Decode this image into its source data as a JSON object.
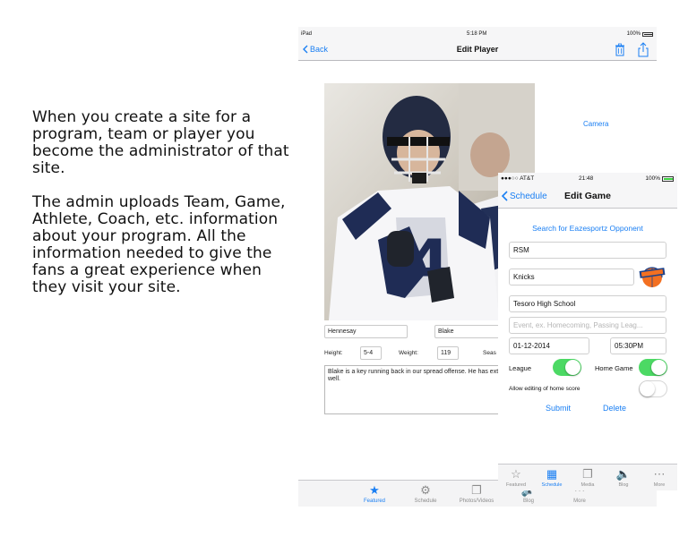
{
  "promo": {
    "paragraph1": "When you create a site for a program, team or player you become the administrator of that site.",
    "paragraph2": "The admin uploads Team, Game, Athlete, Coach, etc. information about your program. All the information needed to give the fans a great experience when they visit your site."
  },
  "ipad": {
    "status": {
      "device": "iPad",
      "time": "5:18 PM",
      "battery": "100%"
    },
    "nav": {
      "back_label": "Back",
      "title": "Edit Player"
    },
    "camera_label": "Camera",
    "fields": {
      "last_name": "Hennesay",
      "first_name": "Blake"
    },
    "labels": {
      "height": "Height:",
      "weight": "Weight:",
      "season": "Seas"
    },
    "values": {
      "height": "5-4",
      "weight": "119"
    },
    "bio": "Blake is a key running back in our spread offense. He has extremely well.",
    "tabs": [
      {
        "label": "Featured",
        "icon": "star-icon"
      },
      {
        "label": "Schedule",
        "icon": "schedule-icon"
      },
      {
        "label": "Photos/Videos",
        "icon": "photos-icon"
      },
      {
        "label": "Blog",
        "icon": "blog-icon"
      },
      {
        "label": "More",
        "icon": "more-icon"
      }
    ]
  },
  "iphone": {
    "status": {
      "carrier": "AT&T",
      "time": "21:48",
      "battery": "100%"
    },
    "nav": {
      "back_label": "Schedule",
      "title": "Edit Game"
    },
    "search_label": "Search for Eazesportz Opponent",
    "fields": {
      "team": "RSM",
      "opponent": "Knicks",
      "location": "Tesoro High School",
      "event_placeholder": "Event, ex. Homecoming, Passing Leag...",
      "date": "01-12-2014",
      "time": "05:30PM"
    },
    "labels": {
      "league": "League",
      "home_game": "Home Game",
      "allow_edit": "Allow editing of home score"
    },
    "actions": {
      "submit": "Submit",
      "delete": "Delete"
    },
    "tabs": [
      {
        "label": "Featured",
        "icon": "star-icon"
      },
      {
        "label": "Schedule",
        "icon": "calendar-icon"
      },
      {
        "label": "Media",
        "icon": "media-icon"
      },
      {
        "label": "Blog",
        "icon": "speaker-icon"
      },
      {
        "label": "More",
        "icon": "more-icon"
      }
    ],
    "toggles": {
      "league": true,
      "home_game": true,
      "allow_edit": false
    }
  },
  "colors": {
    "accent": "#1a7ff3",
    "toggle_on": "#4cd964",
    "jersey_navy": "#1f2c55"
  }
}
